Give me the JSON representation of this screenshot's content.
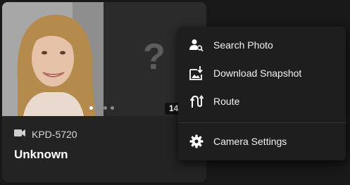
{
  "card": {
    "timestamp": "14:",
    "camera_name": "KPD-5720",
    "person_label": "Unknown",
    "placeholder_symbol": "?",
    "carousel": {
      "count": 4,
      "active_index": 0
    }
  },
  "menu": {
    "items": [
      {
        "label": "Search Photo",
        "icon": "person-search-icon"
      },
      {
        "label": "Download Snapshot",
        "icon": "image-download-icon"
      },
      {
        "label": "Route",
        "icon": "route-icon"
      },
      {
        "label": "Camera Settings",
        "icon": "gear-icon"
      }
    ]
  },
  "colors": {
    "background": "#181818",
    "card": "#232323",
    "menu": "#1e1e1e",
    "text": "#ffffff"
  }
}
